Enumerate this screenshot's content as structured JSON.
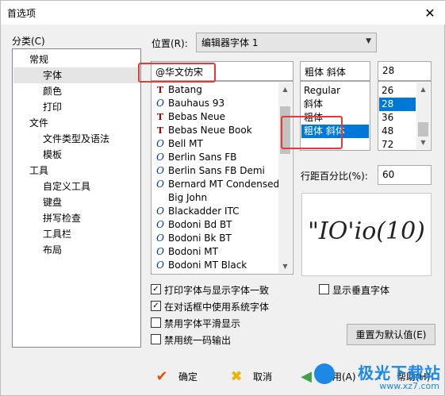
{
  "window": {
    "title": "首选项",
    "close_glyph": "✕"
  },
  "category": {
    "label": "分类(C)",
    "tree": [
      {
        "label": "常规",
        "level": 0
      },
      {
        "label": "字体",
        "level": 1,
        "selected": true
      },
      {
        "label": "颜色",
        "level": 1
      },
      {
        "label": "打印",
        "level": 1
      },
      {
        "label": "文件",
        "level": 0
      },
      {
        "label": "文件类型及语法",
        "level": 1
      },
      {
        "label": "模板",
        "level": 1
      },
      {
        "label": "工具",
        "level": 0
      },
      {
        "label": "自定义工具",
        "level": 1
      },
      {
        "label": "键盘",
        "level": 1
      },
      {
        "label": "拼写检查",
        "level": 1
      },
      {
        "label": "工具栏",
        "level": 1
      },
      {
        "label": "布局",
        "level": 1
      }
    ]
  },
  "position": {
    "label": "位置(R):",
    "value": "编辑器字体 1"
  },
  "font_name": {
    "value": "@华文仿宋",
    "list": [
      {
        "icon": "truetype-icon",
        "glyph": "T",
        "name": "Batang"
      },
      {
        "icon": "opentype-icon",
        "glyph": "O",
        "name": "Bauhaus 93"
      },
      {
        "icon": "truetype-icon",
        "glyph": "T",
        "name": "Bebas Neue"
      },
      {
        "icon": "truetype-icon",
        "glyph": "T",
        "name": "Bebas Neue Book"
      },
      {
        "icon": "opentype-icon",
        "glyph": "O",
        "name": "Bell MT"
      },
      {
        "icon": "opentype-icon",
        "glyph": "O",
        "name": "Berlin Sans FB"
      },
      {
        "icon": "opentype-icon",
        "glyph": "O",
        "name": "Berlin Sans FB Demi"
      },
      {
        "icon": "opentype-icon",
        "glyph": "O",
        "name": "Bernard MT Condensed"
      },
      {
        "icon": "",
        "glyph": "",
        "name": "Big John"
      },
      {
        "icon": "opentype-icon",
        "glyph": "O",
        "name": "Blackadder ITC"
      },
      {
        "icon": "opentype-icon",
        "glyph": "O",
        "name": "Bodoni Bd BT"
      },
      {
        "icon": "opentype-icon",
        "glyph": "O",
        "name": "Bodoni Bk BT"
      },
      {
        "icon": "opentype-icon",
        "glyph": "O",
        "name": "Bodoni MT"
      },
      {
        "icon": "opentype-icon",
        "glyph": "O",
        "name": "Bodoni MT Black"
      }
    ]
  },
  "font_style": {
    "value": "粗体 斜体",
    "options": [
      {
        "label": "Regular"
      },
      {
        "label": "斜体"
      },
      {
        "label": "粗体"
      },
      {
        "label": "粗体 斜体",
        "selected": true
      }
    ]
  },
  "font_size": {
    "value": "28",
    "options": [
      {
        "label": "26"
      },
      {
        "label": "28",
        "selected": true
      },
      {
        "label": "36"
      },
      {
        "label": "48"
      },
      {
        "label": "72"
      }
    ]
  },
  "line_spacing": {
    "label": "行距百分比(%):",
    "value": "60"
  },
  "preview": {
    "text": "\"IO'io(10)"
  },
  "checkboxes": [
    {
      "label": "打印字体与显示字体一致",
      "checked": true
    },
    {
      "label": "在对话框中使用系统字体",
      "checked": true
    },
    {
      "label": "禁用字体平滑显示",
      "checked": false
    },
    {
      "label": "禁用统一码输出",
      "checked": false
    }
  ],
  "vertical_font": {
    "label": "显示垂直字体",
    "checked": false
  },
  "reset_button": "重置为默认值(E)",
  "footer": {
    "ok": "确定",
    "cancel": "取消",
    "apply": "应用(A)",
    "help": "帮助(H)"
  },
  "watermark": {
    "main": "极光下载站",
    "url": "www.xz7.com"
  },
  "colors": {
    "selection": "#0078d7",
    "highlight_box": "#e53935"
  }
}
